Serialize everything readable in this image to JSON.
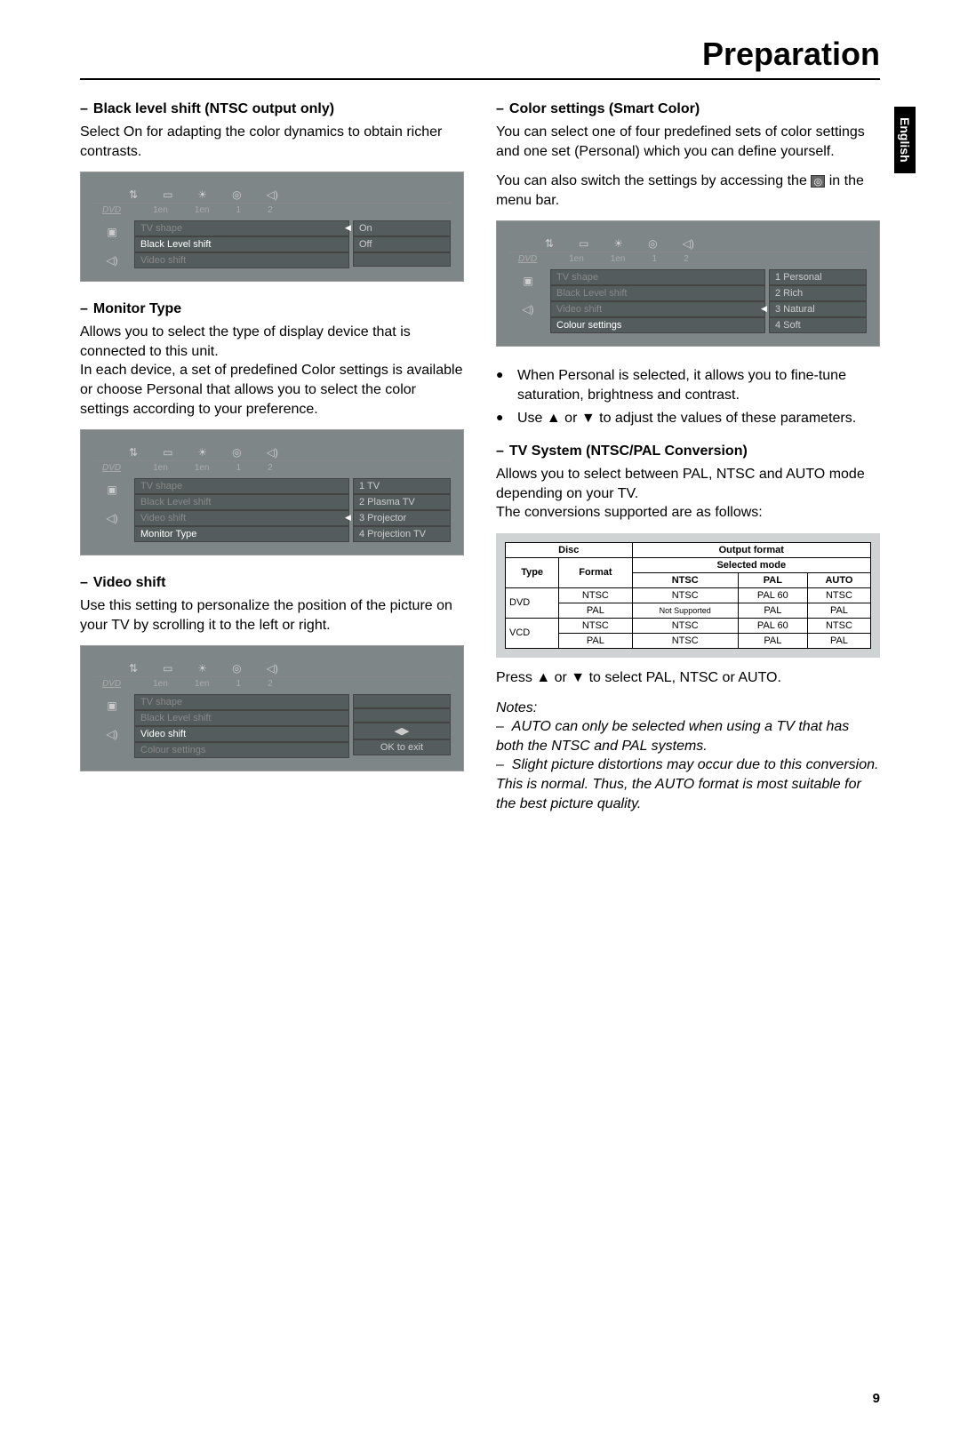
{
  "title": "Preparation",
  "language_tab": "English",
  "page_number": "9",
  "left": {
    "s1": {
      "heading": "Black level shift (NTSC output only)",
      "body": "Select On for adapting the color dynamics to obtain richer contrasts.",
      "menu": {
        "top_icons": [
          "⇅",
          "▭",
          "☀",
          "◎",
          "◁)"
        ],
        "sub": [
          "DVD",
          "1en",
          "1en",
          "1",
          "2"
        ],
        "left_icons": [
          "▣",
          "◁)"
        ],
        "mid": [
          "TV shape",
          "Black Level shift",
          "Video shift"
        ],
        "right": [
          "On",
          "Off"
        ],
        "selected_right": 0,
        "active_mid": 1
      }
    },
    "s2": {
      "heading": "Monitor Type",
      "body": "Allows you to select the type of display device that is connected to this unit.\nIn each device, a set of predefined Color settings is available or choose Personal that allows you to select the  color settings according to your preference.",
      "menu": {
        "top_icons": [
          "⇅",
          "▭",
          "☀",
          "◎",
          "◁)"
        ],
        "sub": [
          "DVD",
          "1en",
          "1en",
          "1",
          "2"
        ],
        "left_icons": [
          "▣",
          "◁)"
        ],
        "mid": [
          "TV shape",
          "Black Level shift",
          "Video shift",
          "Monitor Type"
        ],
        "right": [
          "1 TV",
          "2 Plasma TV",
          "3 Projector",
          "4 Projection TV"
        ],
        "selected_right": 2,
        "active_mid": 3
      }
    },
    "s3": {
      "heading": "Video shift",
      "body": "Use this setting to personalize the position of the picture on your TV by scrolling it to the left or right.",
      "menu": {
        "top_icons": [
          "⇅",
          "▭",
          "☀",
          "◎",
          "◁)"
        ],
        "sub": [
          "DVD",
          "1en",
          "1en",
          "1",
          "2"
        ],
        "left_icons": [
          "▣",
          "◁)"
        ],
        "mid": [
          "TV shape",
          "Black Level shift",
          "Video shift",
          "Colour settings"
        ],
        "right": [
          "",
          "",
          "◀▶",
          "OK to exit"
        ],
        "selected_right": -1,
        "active_mid": 2
      }
    }
  },
  "right": {
    "s1": {
      "heading": "Color settings (Smart Color)",
      "body1": "You can select one of four predefined sets of color settings and one set (Personal) which you can define yourself.",
      "body2a": "You can also switch the settings by accessing the ",
      "body2b": " in the menu bar.",
      "menu": {
        "top_icons": [
          "⇅",
          "▭",
          "☀",
          "◎",
          "◁)"
        ],
        "sub": [
          "DVD",
          "1en",
          "1en",
          "1",
          "2"
        ],
        "left_icons": [
          "▣",
          "◁)"
        ],
        "mid": [
          "TV shape",
          "Black Level shift",
          "Video shift",
          "Colour settings"
        ],
        "right": [
          "1 Personal",
          "2 Rich",
          "3 Natural",
          "4 Soft"
        ],
        "selected_right": 2,
        "active_mid": 3
      },
      "bullets": [
        "When Personal is selected, it allows you to fine-tune saturation, brightness and contrast.",
        "Use ▲ or ▼ to adjust the values of these parameters."
      ]
    },
    "s2": {
      "heading": "TV System (NTSC/PAL Conversion)",
      "body": "Allows you to select between PAL, NTSC and AUTO mode depending on your TV.\nThe conversions supported are as follows:",
      "table": {
        "h1": [
          "Disc",
          "Output format"
        ],
        "h2": [
          "Type",
          "Format",
          "Selected mode"
        ],
        "h3": [
          "NTSC",
          "PAL",
          "AUTO"
        ],
        "rows": [
          [
            "DVD",
            "NTSC",
            "NTSC",
            "PAL 60",
            "NTSC"
          ],
          [
            "",
            "PAL",
            "Not Supported",
            "PAL",
            "PAL"
          ],
          [
            "VCD",
            "NTSC",
            "NTSC",
            "PAL 60",
            "NTSC"
          ],
          [
            "",
            "PAL",
            "NTSC",
            "PAL",
            "PAL"
          ]
        ]
      },
      "after_table": "Press ▲ or ▼ to select PAL, NTSC or AUTO.",
      "notes_label": "Notes:",
      "notes": [
        "AUTO can only be selected when using a TV that has both the NTSC and PAL systems.",
        "Slight picture distortions may occur due to this conversion. This is normal. Thus, the AUTO format is most suitable for the best picture quality."
      ]
    }
  }
}
